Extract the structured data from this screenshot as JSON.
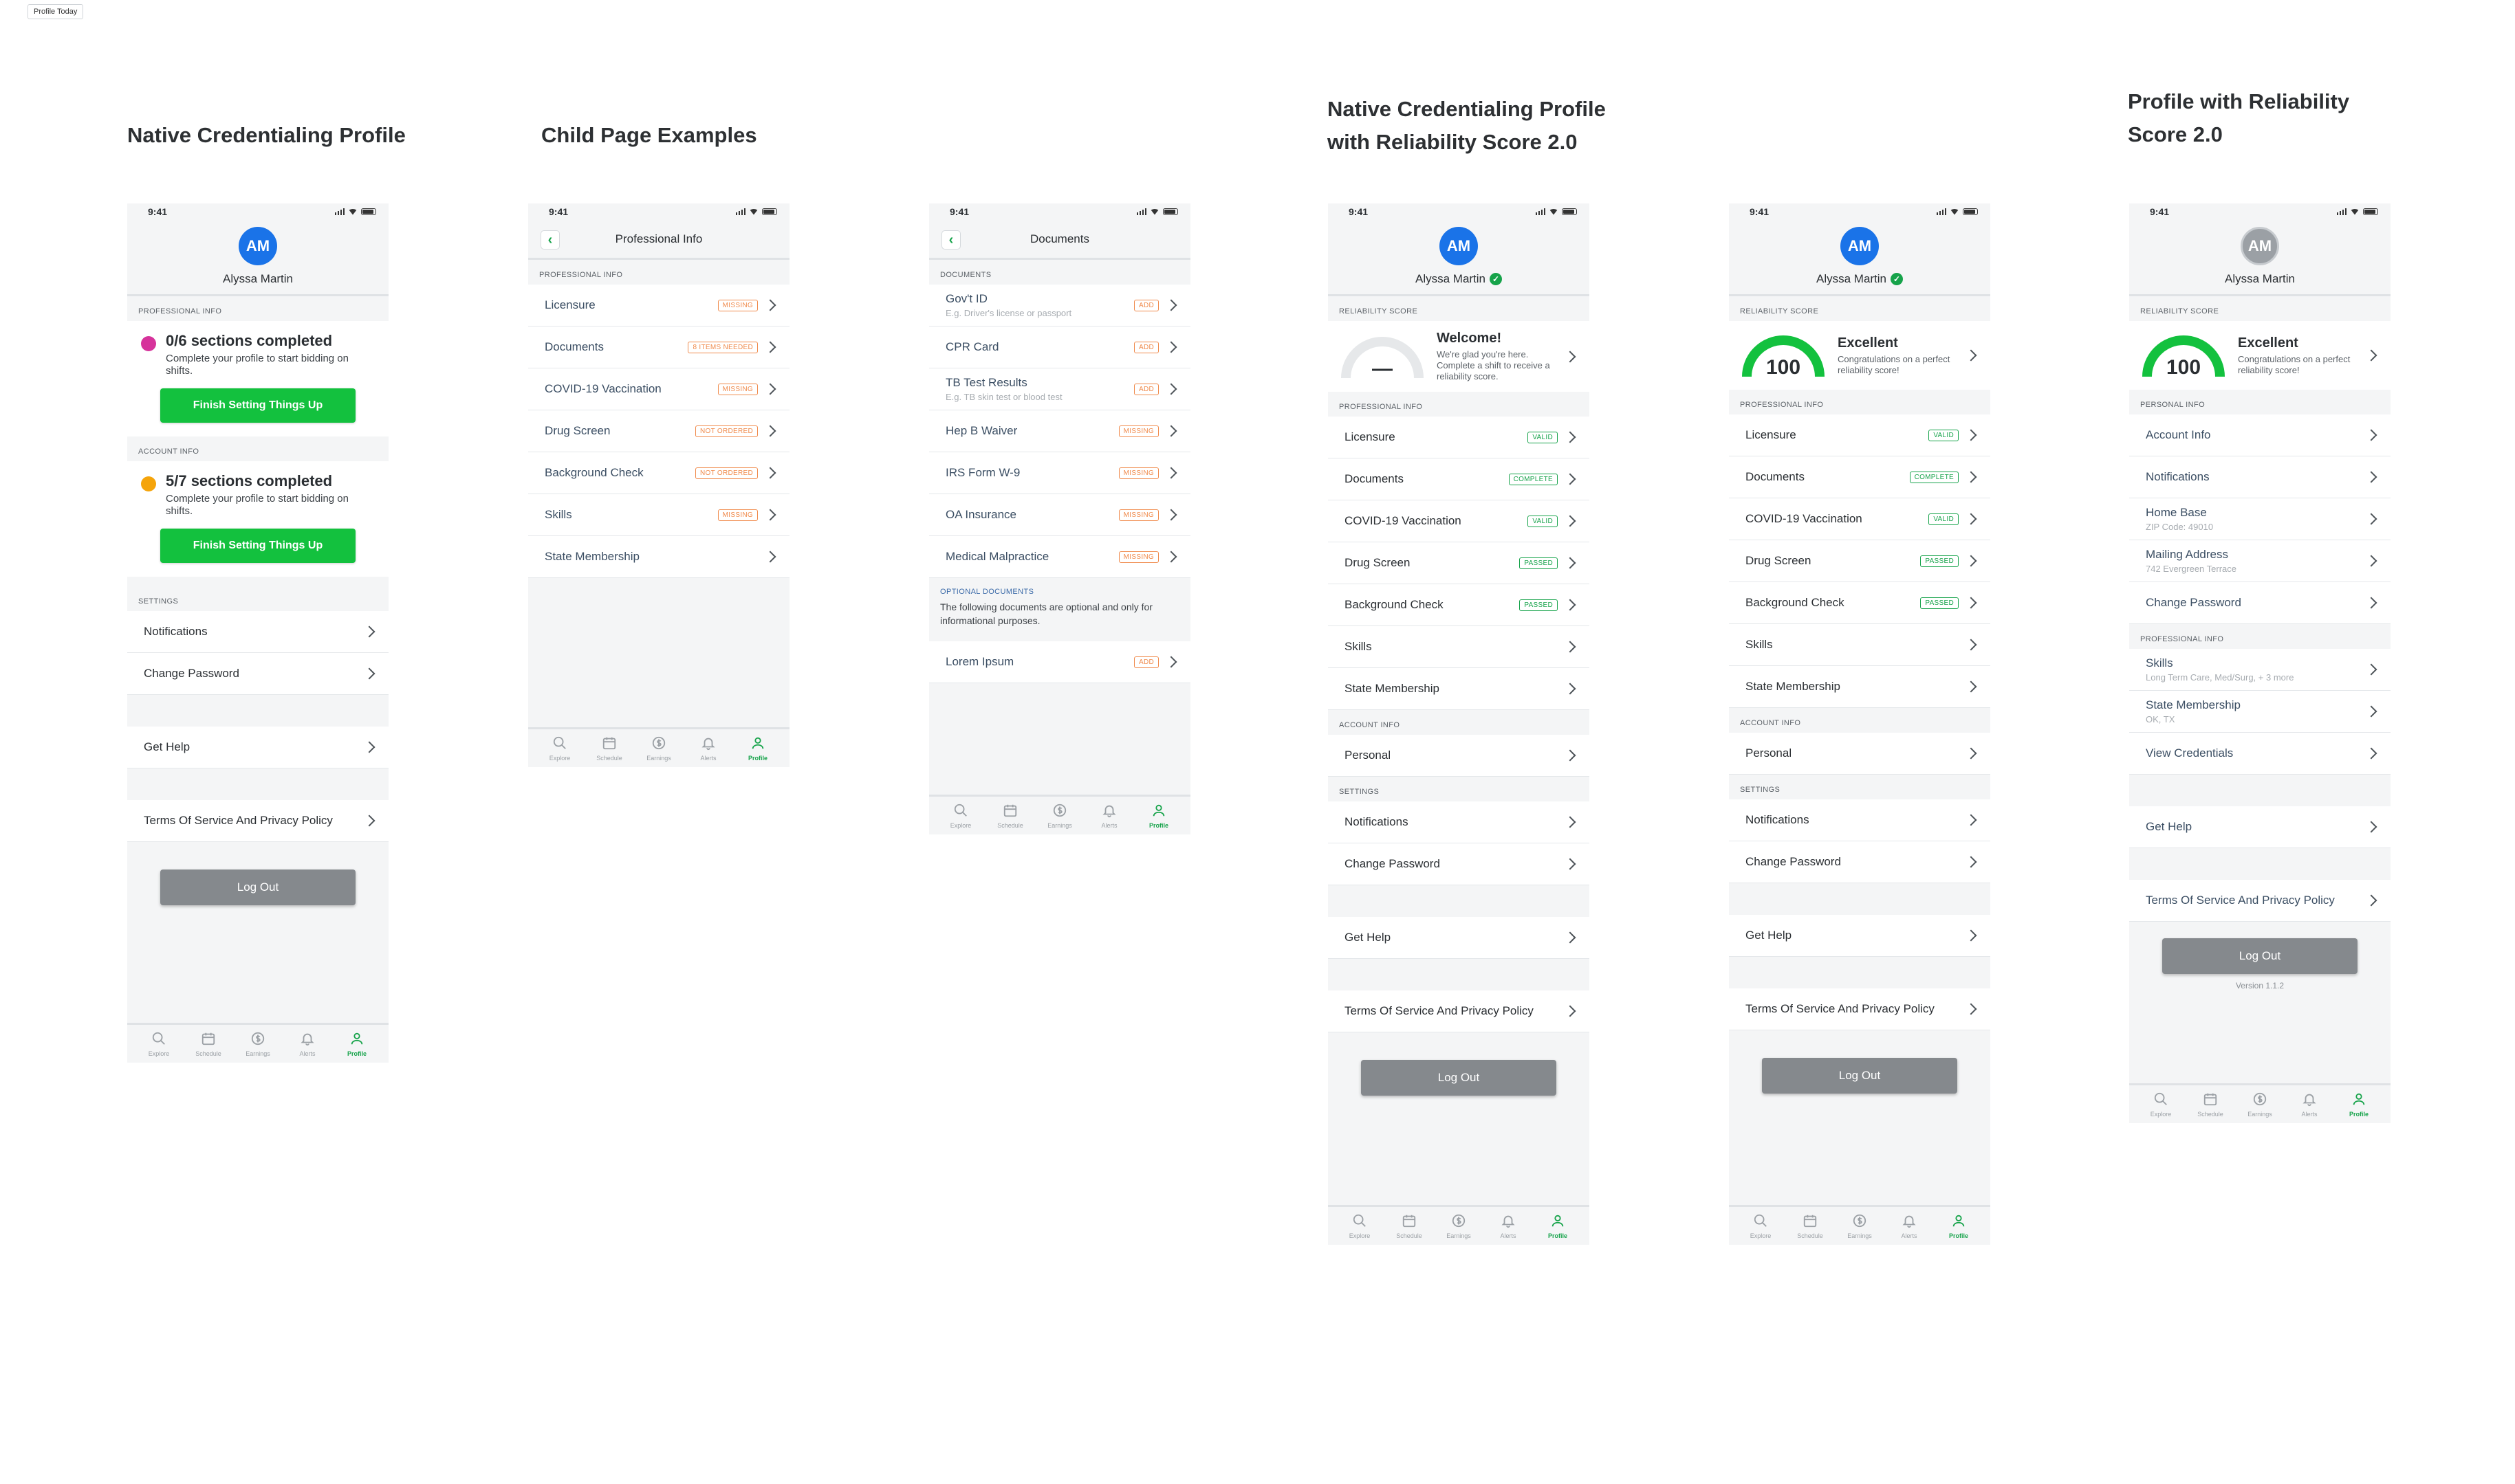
{
  "page_tag": "Profile Today",
  "headings": [
    "Native Credentialing Profile",
    "Child Page Examples",
    "Native Credentialing Profile\nwith Reliability Score 2.0",
    "Profile with Reliability\nScore 2.0"
  ],
  "time": "9:41",
  "user": {
    "initials": "AM",
    "name": "Alyssa Martin"
  },
  "tabs": [
    "Explore",
    "Schedule",
    "Earnings",
    "Alerts",
    "Profile"
  ],
  "s1": {
    "prof_header": "PROFESSIONAL INFO",
    "prof_title": "0/6 sections completed",
    "prof_desc": "Complete your profile to start bidding on shifts.",
    "btn": "Finish Setting Things Up",
    "acct_header": "ACCOUNT INFO",
    "acct_title": "5/7 sections completed",
    "acct_desc": "Complete your profile to start bidding on shifts.",
    "settings_header": "SETTINGS",
    "notifications": "Notifications",
    "change_password": "Change Password",
    "get_help": "Get Help",
    "terms": "Terms Of Service And Privacy Policy",
    "logout": "Log Out",
    "colors": {
      "prof_dot": "#d6339b",
      "acct_dot": "#f5a40a"
    }
  },
  "s2": {
    "title": "Professional Info",
    "header": "PROFESSIONAL INFO",
    "rows": [
      {
        "label": "Licensure",
        "badge": "MISSING"
      },
      {
        "label": "Documents",
        "badge": "8 ITEMS NEEDED"
      },
      {
        "label": "COVID-19 Vaccination",
        "badge": "MISSING"
      },
      {
        "label": "Drug Screen",
        "badge": "NOT ORDERED"
      },
      {
        "label": "Background Check",
        "badge": "NOT ORDERED"
      },
      {
        "label": "Skills",
        "badge": "MISSING"
      },
      {
        "label": "State Membership",
        "badge": ""
      }
    ]
  },
  "s3": {
    "title": "Documents",
    "header": "DOCUMENTS",
    "rows": [
      {
        "label": "Gov't ID",
        "sub": "E.g. Driver's license or passport",
        "badge": "ADD"
      },
      {
        "label": "CPR Card",
        "sub": "",
        "badge": "ADD"
      },
      {
        "label": "TB Test Results",
        "sub": "E.g. TB skin test or blood test",
        "badge": "ADD"
      },
      {
        "label": "Hep B Waiver",
        "sub": "",
        "badge": "MISSING"
      },
      {
        "label": "IRS Form W-9",
        "sub": "",
        "badge": "MISSING"
      },
      {
        "label": "OA Insurance",
        "sub": "",
        "badge": "MISSING"
      },
      {
        "label": "Medical Malpractice",
        "sub": "",
        "badge": "MISSING"
      }
    ],
    "optional_header": "OPTIONAL DOCUMENTS",
    "optional_desc": "The following documents are optional and only for informational purposes.",
    "optional_rows": [
      {
        "label": "Lorem Ipsum",
        "badge": "ADD"
      }
    ]
  },
  "s4": {
    "rs_header": "RELIABILITY SCORE",
    "rs_title": "Welcome!",
    "rs_desc": "We're glad you're here. Complete a shift to receive a reliability score.",
    "rs_value": "—",
    "prof_header": "PROFESSIONAL INFO",
    "rows": [
      {
        "label": "Licensure",
        "badge": "VALID"
      },
      {
        "label": "Documents",
        "badge": "COMPLETE"
      },
      {
        "label": "COVID-19 Vaccination",
        "badge": "VALID"
      },
      {
        "label": "Drug Screen",
        "badge": "PASSED"
      },
      {
        "label": "Background Check",
        "badge": "PASSED"
      },
      {
        "label": "Skills",
        "badge": ""
      },
      {
        "label": "State Membership",
        "badge": ""
      }
    ],
    "acct_header": "ACCOUNT INFO",
    "personal": "Personal",
    "settings_header": "SETTINGS",
    "notifications": "Notifications",
    "change_password": "Change Password",
    "get_help": "Get Help",
    "terms": "Terms Of Service And Privacy Policy",
    "logout": "Log Out"
  },
  "s5": {
    "rs_header": "RELIABILITY SCORE",
    "rs_title": "Excellent",
    "rs_desc": "Congratulations on a perfect reliability score!",
    "rs_value": "100",
    "rs_fraction": 1,
    "prof_header": "PROFESSIONAL INFO",
    "rows": [
      {
        "label": "Licensure",
        "badge": "VALID"
      },
      {
        "label": "Documents",
        "badge": "COMPLETE"
      },
      {
        "label": "COVID-19 Vaccination",
        "badge": "VALID"
      },
      {
        "label": "Drug Screen",
        "badge": "PASSED"
      },
      {
        "label": "Background Check",
        "badge": "PASSED"
      },
      {
        "label": "Skills",
        "badge": ""
      },
      {
        "label": "State Membership",
        "badge": ""
      }
    ],
    "acct_header": "ACCOUNT INFO",
    "personal": "Personal",
    "settings_header": "SETTINGS",
    "notifications": "Notifications",
    "change_password": "Change Password",
    "get_help": "Get Help",
    "terms": "Terms Of Service And Privacy Policy",
    "logout": "Log Out"
  },
  "s6": {
    "rs_header": "RELIABILITY SCORE",
    "rs_title": "Excellent",
    "rs_desc": "Congratulations on a perfect reliability score!",
    "rs_value": "100",
    "personal_header": "PERSONAL INFO",
    "personal_rows": [
      {
        "label": "Account Info",
        "sub": ""
      },
      {
        "label": "Notifications",
        "sub": ""
      },
      {
        "label": "Home Base",
        "sub": "ZIP Code: 49010"
      },
      {
        "label": "Mailing Address",
        "sub": "742 Evergreen Terrace"
      },
      {
        "label": "Change Password",
        "sub": ""
      }
    ],
    "prof_header": "PROFESSIONAL INFO",
    "prof_rows": [
      {
        "label": "Skills",
        "sub": "Long Term Care, Med/Surg, + 3 more"
      },
      {
        "label": "State Membership",
        "sub": "OK, TX"
      },
      {
        "label": "View Credentials",
        "sub": ""
      }
    ],
    "get_help": "Get Help",
    "terms": "Terms Of Service And Privacy Policy",
    "logout": "Log Out",
    "version": "Version 1.1.2"
  },
  "colors": {
    "green": "#13c13e",
    "blue": "#1a73e8",
    "orange": "#f08a4b"
  }
}
